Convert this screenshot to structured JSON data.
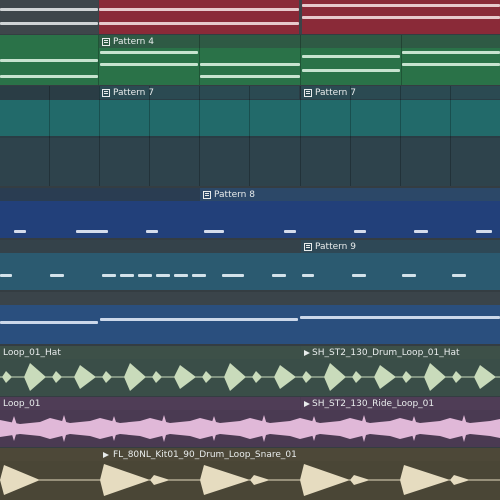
{
  "colors": {
    "background": "#343d42",
    "track_red": "#8a2a38",
    "track_green": "#2a7248",
    "track_teal": "#226a6a",
    "track_dark": "#2a3d45",
    "track_blue": "#22407a",
    "track_slate": "#2b5a70",
    "track_navy": "#2a4f7e",
    "wave_green": "#c9dbbb",
    "wave_pink": "#e0b8d8",
    "wave_cream": "#e6dcc0"
  },
  "clips": {
    "pattern_4": "Pattern 4",
    "pattern_7a": "Pattern 7",
    "pattern_7b": "Pattern 7",
    "pattern_8": "Pattern 8",
    "pattern_9": "Pattern 9",
    "hat_left": "Loop_01_Hat",
    "hat_right": "SH_ST2_130_Drum_Loop_01_Hat",
    "ride_left": "Loop_01",
    "ride_right": "SH_ST2_130_Ride_Loop_01",
    "snare": "FL_80NL_Kit01_90_Drum_Loop_Snare_01"
  },
  "icons": {
    "pattern_clip": "pattern-icon",
    "audio_clip": "audio-play-icon"
  }
}
